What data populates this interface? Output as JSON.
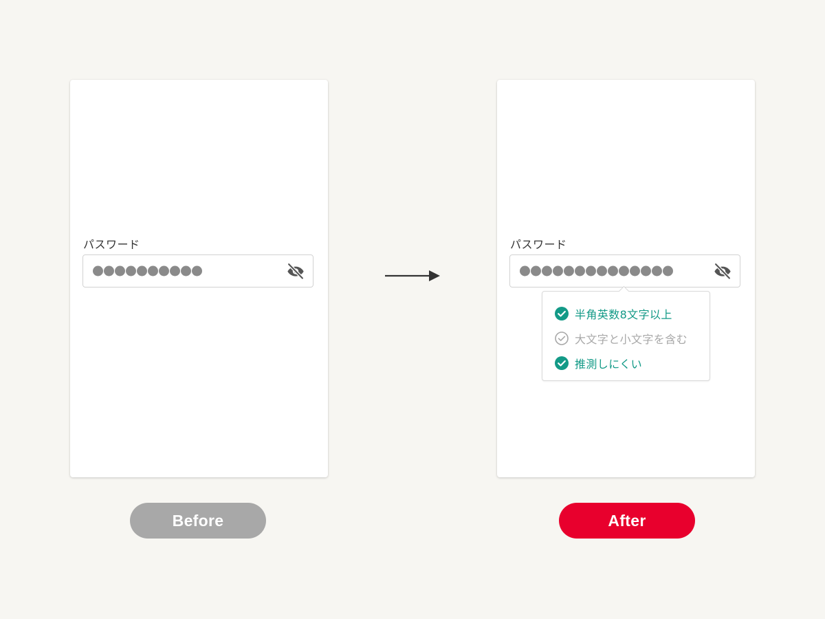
{
  "colors": {
    "background": "#f7f6f2",
    "before_pill": "#a8a8a8",
    "after_pill": "#e8002d",
    "requirement_met": "#139a87",
    "requirement_unmet": "#a8a8a8",
    "dot": "#8a8a8a"
  },
  "before": {
    "label": "パスワード",
    "password_dot_count": 10,
    "visibility_icon": "eye-off-icon",
    "tag": "Before"
  },
  "after": {
    "label": "パスワード",
    "password_dot_count": 14,
    "visibility_icon": "eye-off-icon",
    "tag": "After",
    "requirements": [
      {
        "text": "半角英数8文字以上",
        "met": true,
        "icon": "check-circle-filled-icon"
      },
      {
        "text": "大文字と小文字を含む",
        "met": false,
        "icon": "check-circle-outline-icon"
      },
      {
        "text": "推測しにくい",
        "met": true,
        "icon": "check-circle-filled-icon"
      }
    ]
  },
  "transition_icon": "arrow-right-icon"
}
